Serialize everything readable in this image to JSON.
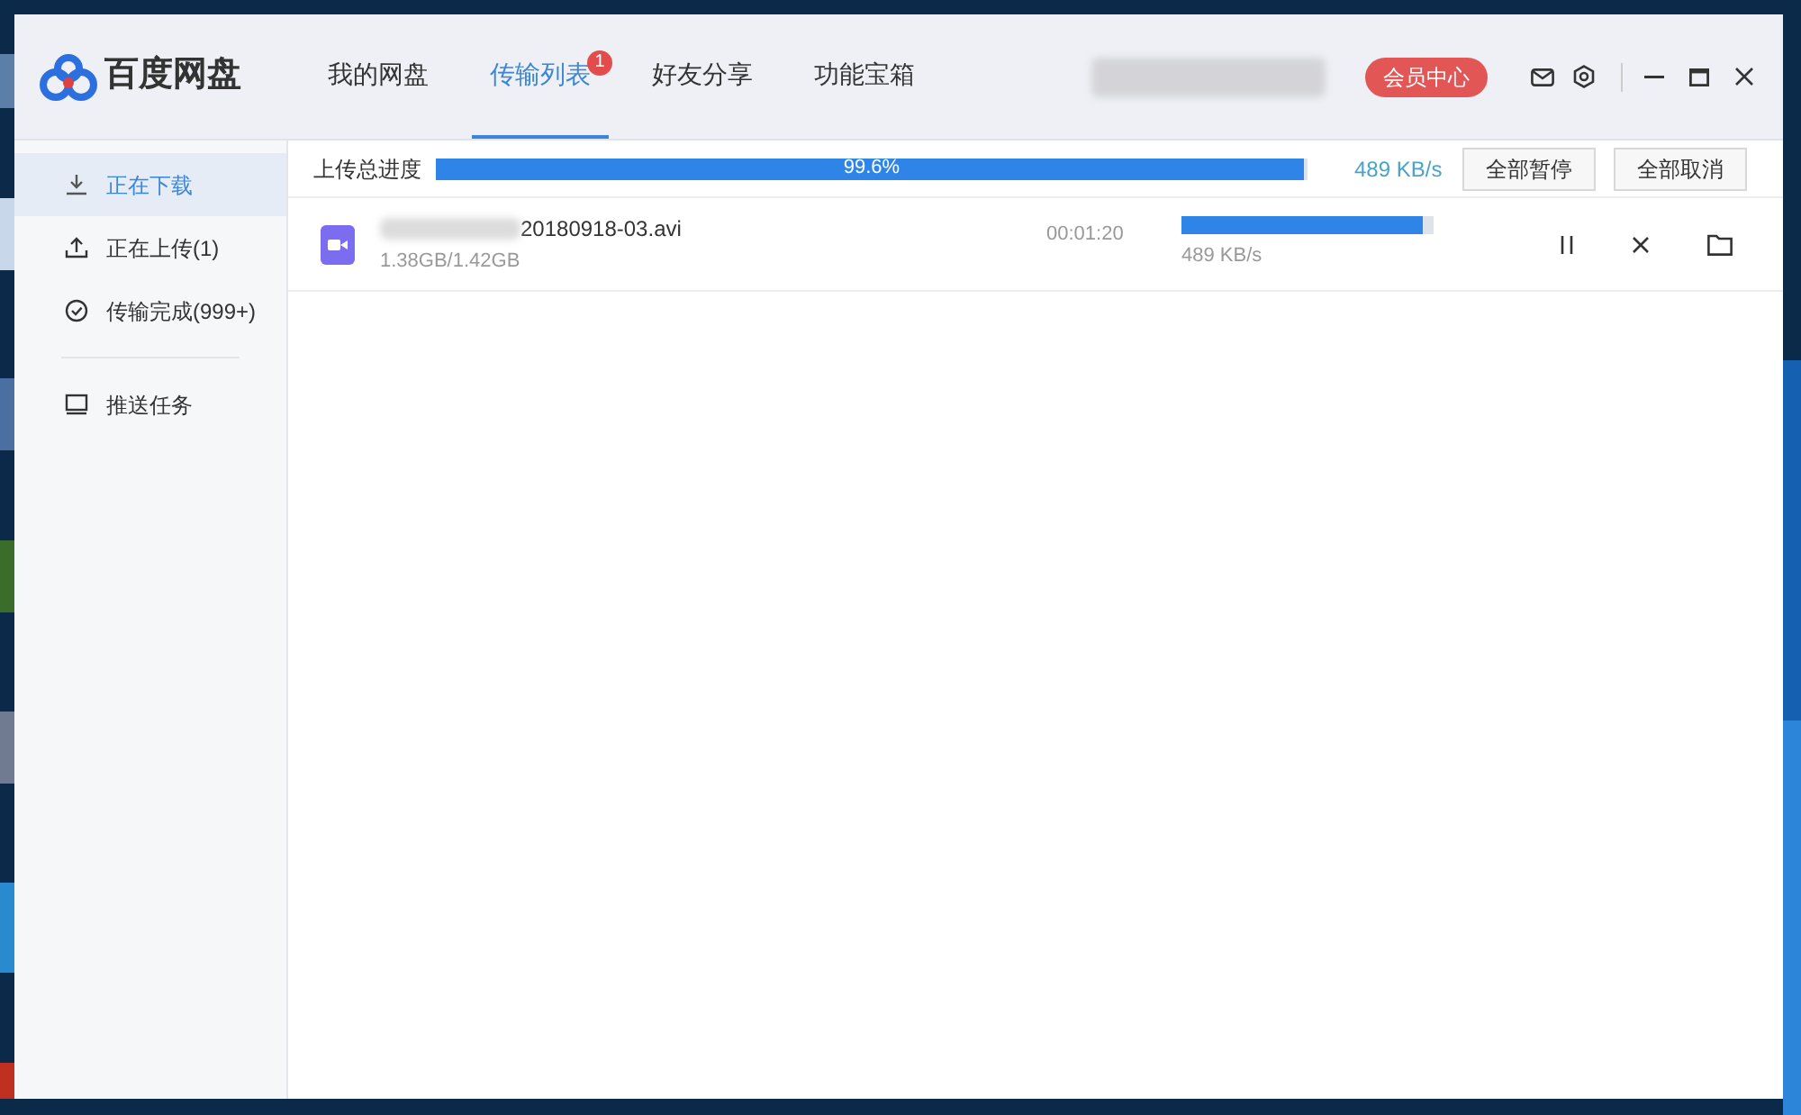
{
  "app": {
    "name": "百度网盘"
  },
  "nav_tabs": [
    {
      "label": "我的网盘",
      "selected": false
    },
    {
      "label": "传输列表",
      "selected": true,
      "badge": "1"
    },
    {
      "label": "好友分享",
      "selected": false
    },
    {
      "label": "功能宝箱",
      "selected": false
    }
  ],
  "vip_button": "会员中心",
  "sidebar": {
    "items": [
      {
        "label": "正在下载",
        "kind": "download",
        "selected": true
      },
      {
        "label": "正在上传(1)",
        "kind": "upload",
        "selected": false
      },
      {
        "label": "传输完成(999+)",
        "kind": "check",
        "selected": false
      },
      {
        "label": "推送任务",
        "kind": "monitor",
        "selected": false,
        "divider_before": true
      }
    ]
  },
  "total_progress": {
    "label": "上传总进度",
    "level": 0.996,
    "percent": "99.6%",
    "speed": "489 KB/s",
    "buttons": [
      "全部暂停",
      "全部取消"
    ]
  },
  "transfers": [
    {
      "filename": "20180918-03.avi",
      "size": "1.38GB/1.42GB",
      "time_left": "00:01:20",
      "level": 0.96,
      "speed": "489 KB/s"
    }
  ]
}
